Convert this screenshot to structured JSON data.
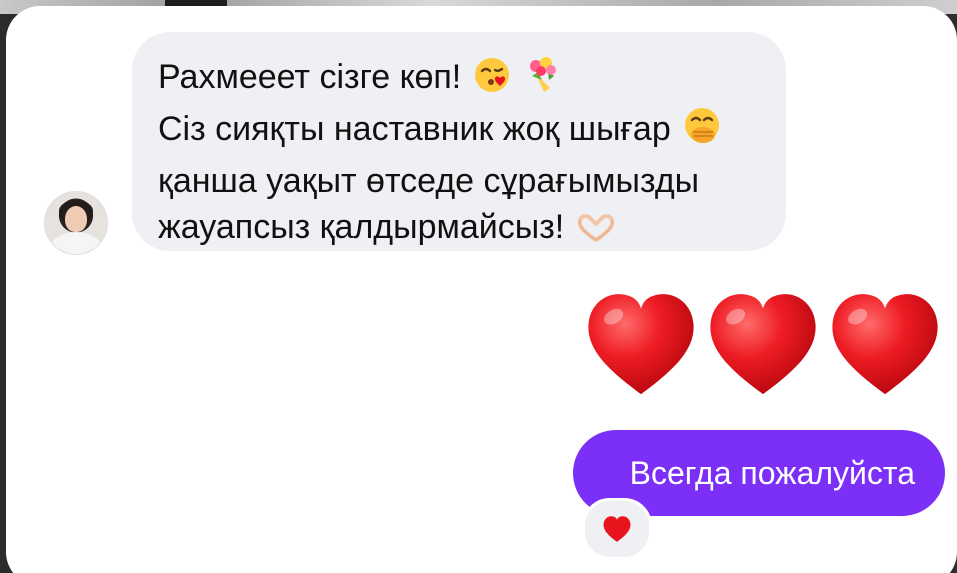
{
  "conversation": {
    "incoming": {
      "lines": [
        "Рахмееет сізге көп!",
        "Сіз сияқты наставник жоқ шығар",
        "қанша уақыт өтседе сұрағымызды",
        "жауапсыз қалдырмайсыз!"
      ],
      "emoji": {
        "line0": [
          "kissing-face-icon",
          "bouquet-icon"
        ],
        "line1": [
          "face-with-hand-over-mouth-icon"
        ],
        "line3": [
          "heart-hands-icon"
        ]
      }
    },
    "outgoing_hearts": {
      "count": 3,
      "icon": "red-heart-icon"
    },
    "outgoing_text": "Всегда пожалуйста",
    "reaction": "red-heart-icon"
  },
  "colors": {
    "incoming_bubble": "#eff0f4",
    "outgoing_bubble": "#7b2ff7",
    "heart": "#e8141d"
  }
}
